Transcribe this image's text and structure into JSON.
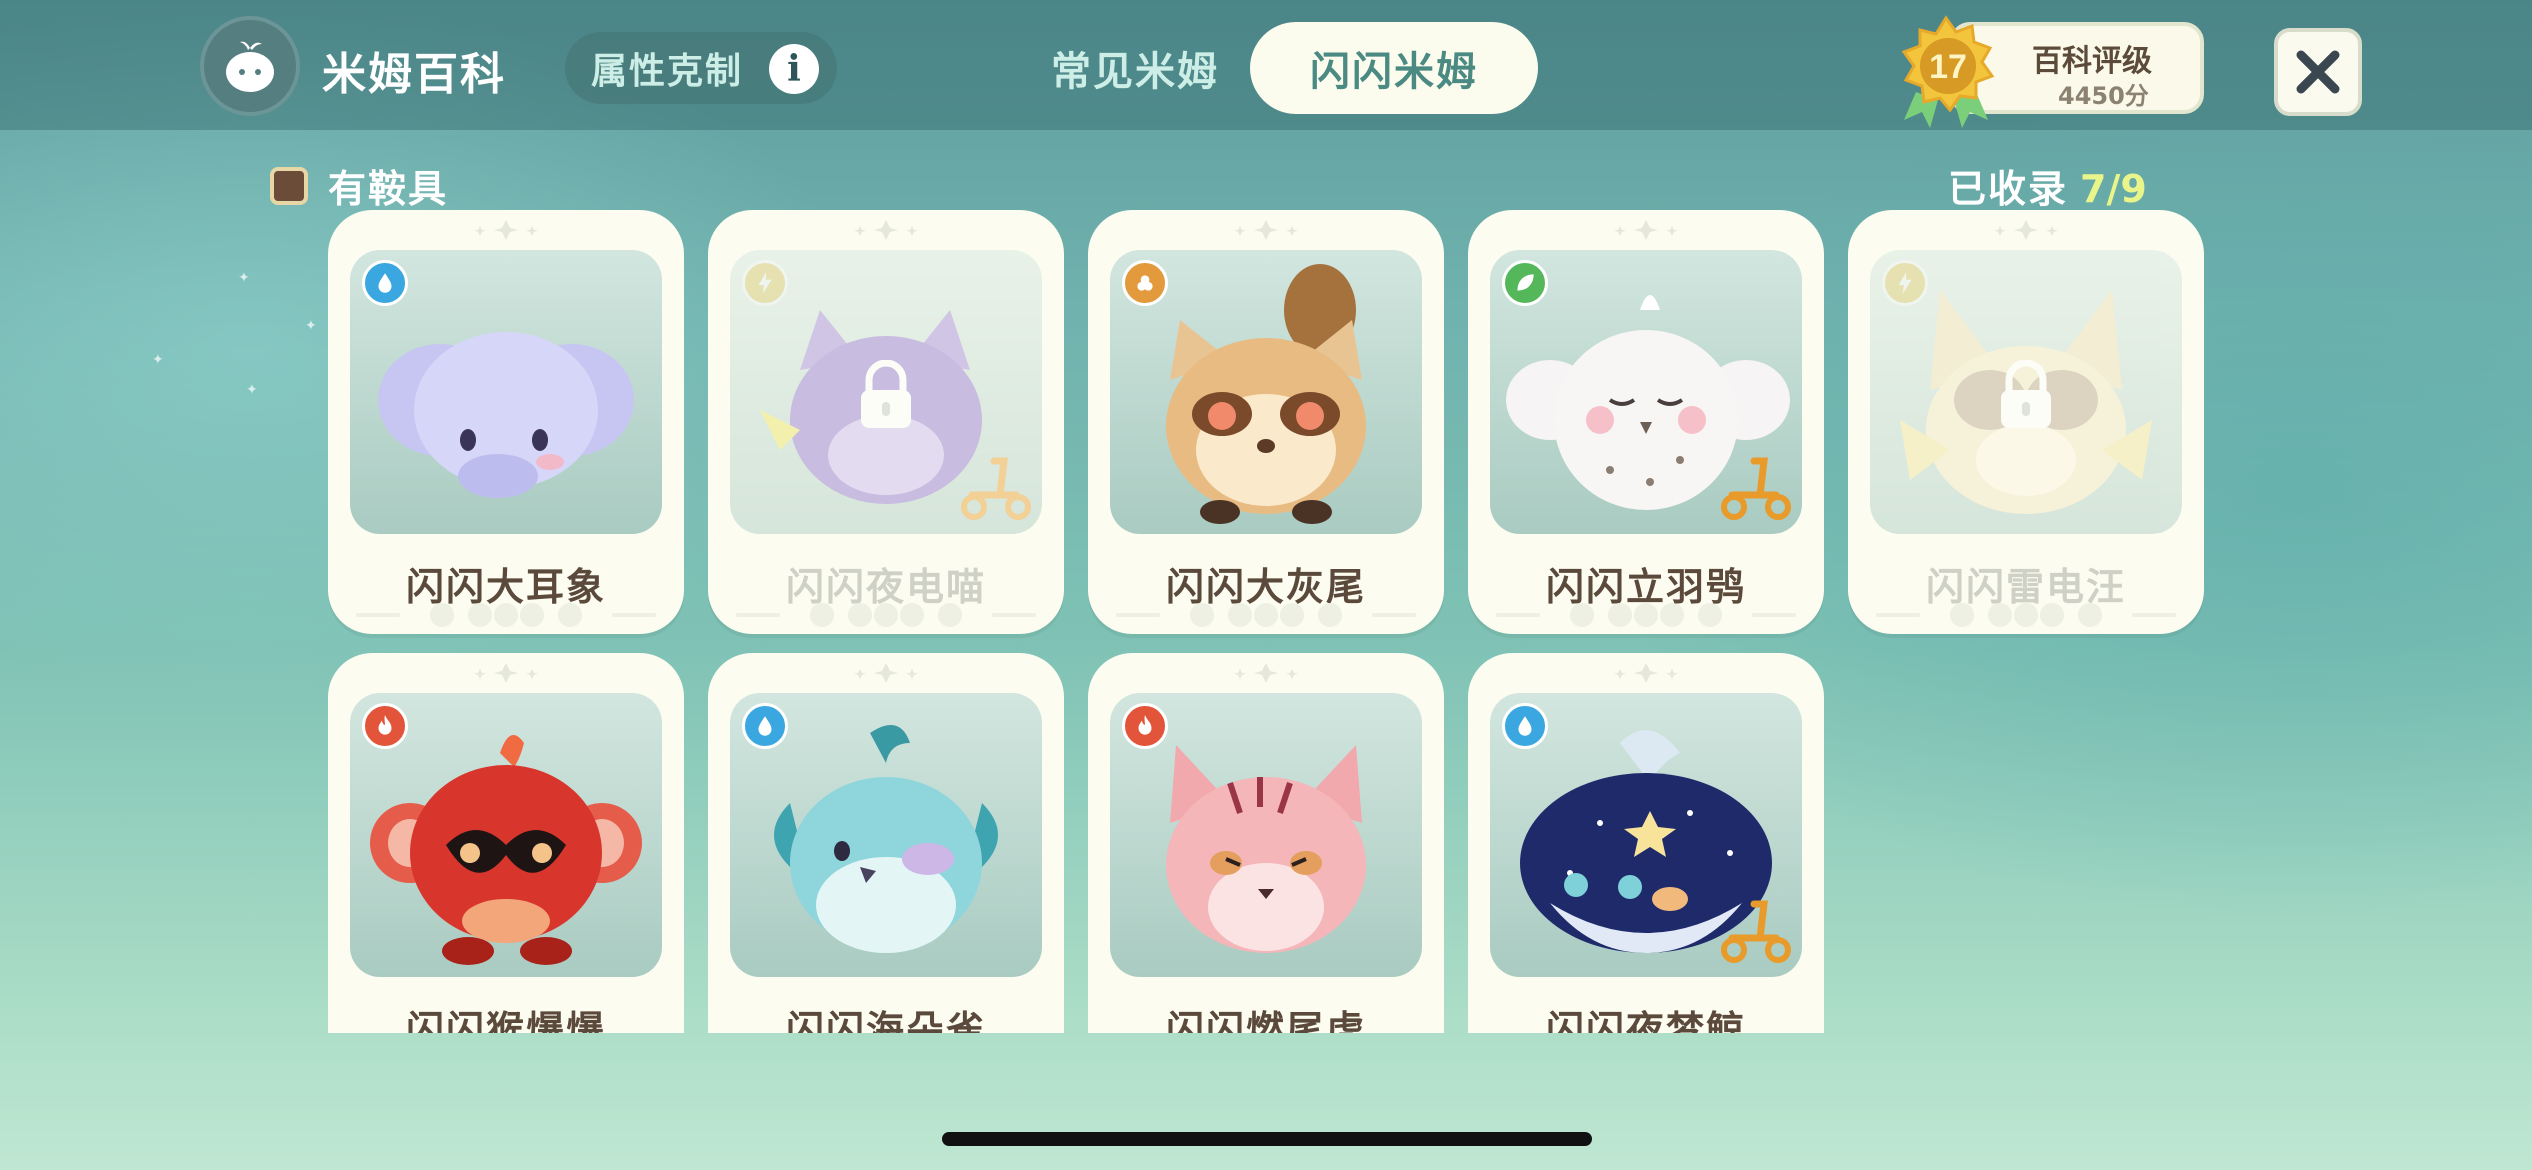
{
  "header": {
    "app_title": "米姆百科",
    "attr_button_label": "属性克制",
    "info_glyph": "i",
    "tabs": [
      {
        "label": "常见米姆",
        "active": false
      },
      {
        "label": "闪闪米姆",
        "active": true
      }
    ],
    "rating": {
      "level": "17",
      "title": "百科评级",
      "score": "4450分"
    },
    "close_icon": "close-icon"
  },
  "filter": {
    "saddle_label": "有鞍具",
    "checked": false
  },
  "collection": {
    "label": "已收录",
    "count": "7/9"
  },
  "colors": {
    "water": "#3aa7e0",
    "electric": "#e7c64e",
    "earth": "#e39a3c",
    "grass": "#54b85a",
    "fire": "#e2553a",
    "accent_tab_text": "#4a8a82",
    "collected_count": "#e9f58a"
  },
  "cards": [
    {
      "name": "闪闪大耳象",
      "element": "water",
      "element_icon": "water-drop-icon",
      "locked": false,
      "scooter": false,
      "creature": "elephant"
    },
    {
      "name": "闪闪夜电喵",
      "element": "electric",
      "element_icon": "lightning-icon",
      "locked": true,
      "scooter": true,
      "creature": "cat"
    },
    {
      "name": "闪闪大灰尾",
      "element": "earth",
      "element_icon": "rock-icon",
      "locked": false,
      "scooter": false,
      "creature": "raccoon"
    },
    {
      "name": "闪闪立羽鸮",
      "element": "grass",
      "element_icon": "leaf-icon",
      "locked": false,
      "scooter": true,
      "creature": "owl"
    },
    {
      "name": "闪闪雷电汪",
      "element": "electric",
      "element_icon": "lightning-icon",
      "locked": true,
      "scooter": false,
      "creature": "dog"
    },
    {
      "name": "闪闪猴爆爆",
      "element": "fire",
      "element_icon": "flame-icon",
      "locked": false,
      "scooter": false,
      "creature": "monkey"
    },
    {
      "name": "闪闪海朵雀",
      "element": "water",
      "element_icon": "water-drop-icon",
      "locked": false,
      "scooter": false,
      "creature": "bird"
    },
    {
      "name": "闪闪燃尾虎",
      "element": "fire",
      "element_icon": "flame-icon",
      "locked": false,
      "scooter": false,
      "creature": "tiger"
    },
    {
      "name": "闪闪夜梦鲸",
      "element": "water",
      "element_icon": "water-drop-icon",
      "locked": false,
      "scooter": true,
      "creature": "whale"
    }
  ]
}
